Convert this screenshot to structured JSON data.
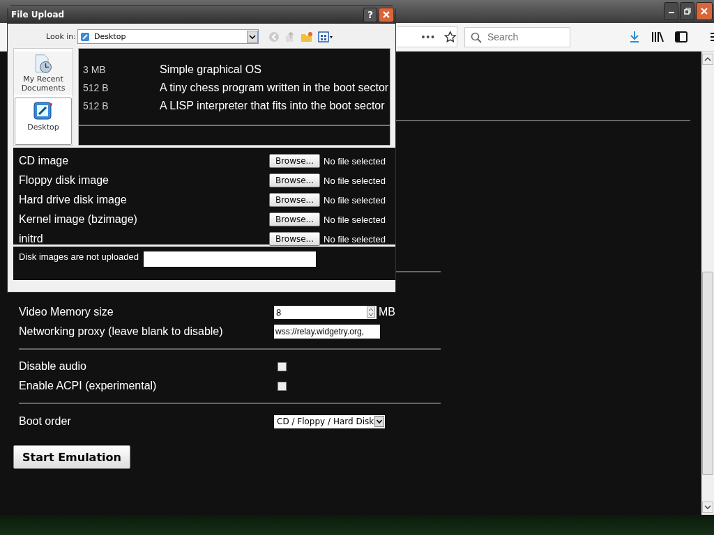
{
  "browser": {
    "search": {
      "placeholder": "Search"
    }
  },
  "dialog": {
    "title": "File Upload",
    "help": "?",
    "look_in": {
      "label": "Look in:",
      "value": "Desktop"
    },
    "places": [
      {
        "label": "My Recent Documents",
        "kind": "recent",
        "selected": false
      },
      {
        "label": "Desktop",
        "kind": "desktop",
        "selected": true
      }
    ],
    "files": [
      {
        "size": "3 MB",
        "description": "Simple graphical OS"
      },
      {
        "size": "512 B",
        "description": "A tiny chess program written in the boot sector"
      },
      {
        "size": "512 B",
        "description": "A LISP interpreter that fits into the boot sector"
      }
    ],
    "uploads": [
      {
        "label": "CD image",
        "button": "Browse...",
        "status": "No file selected"
      },
      {
        "label": "Floppy disk image",
        "button": "Browse...",
        "status": "No file selected"
      },
      {
        "label": "Hard drive disk image",
        "button": "Browse...",
        "status": "No file selected"
      },
      {
        "label": "Kernel image (bzimage)",
        "button": "Browse...",
        "status": "No file selected"
      },
      {
        "label": "initrd",
        "button": "Browse...",
        "status": "No file selected"
      }
    ],
    "note": "Disk images are not uploaded"
  },
  "settings": {
    "video_memory": {
      "label": "Video Memory size",
      "value": "8",
      "unit": "MB"
    },
    "proxy": {
      "label": "Networking proxy (leave blank to disable)",
      "value": "wss://relay.widgetry.org,"
    },
    "checkboxes": [
      {
        "label": "Disable audio",
        "checked": false
      },
      {
        "label": "Enable ACPI (experimental)",
        "checked": false
      }
    ],
    "boot_order": {
      "label": "Boot order",
      "value": "CD / Floppy / Hard Disk"
    },
    "start_button": "Start Emulation"
  }
}
